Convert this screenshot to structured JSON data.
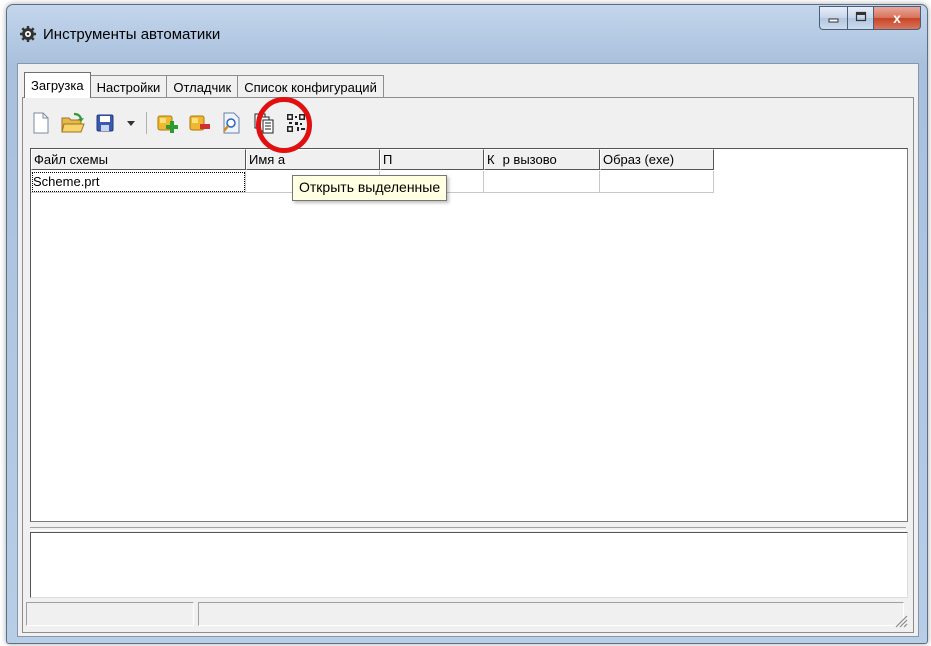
{
  "window": {
    "title": "Инструменты автоматики",
    "icon": "gear-app-icon",
    "controls": {
      "minimize": "minimize-icon",
      "maximize": "maximize-icon",
      "close": "x"
    }
  },
  "tabs": [
    {
      "label": "Загрузка",
      "active": true
    },
    {
      "label": "Настройки",
      "active": false
    },
    {
      "label": "Отладчик",
      "active": false
    },
    {
      "label": "Список конфигураций",
      "active": false
    }
  ],
  "toolbar": {
    "buttons": [
      {
        "name": "new-icon"
      },
      {
        "name": "open-folder-icon"
      },
      {
        "name": "save-icon"
      },
      {
        "name": "dropdown-arrow-icon"
      },
      {
        "name": "add-scheme-icon"
      },
      {
        "name": "remove-scheme-icon"
      },
      {
        "name": "open-selected-icon"
      },
      {
        "name": "copy-pages-icon"
      },
      {
        "name": "qr-grid-icon"
      }
    ]
  },
  "tooltip": {
    "text": "Открыть выделенные"
  },
  "grid": {
    "columns": [
      "Файл схемы",
      "Имя а",
      "П",
      "К",
      "р вызово",
      "Образ (exe)"
    ],
    "rows": [
      [
        "Scheme.prt",
        "",
        "",
        "",
        "",
        ""
      ]
    ]
  },
  "status": {
    "panels": [
      "",
      ""
    ]
  },
  "colors": {
    "highlight": "#e01010",
    "tooltip_bg": "#ffffe1",
    "titlebar": "#b6cbe4",
    "close_btn": "#c74324"
  }
}
